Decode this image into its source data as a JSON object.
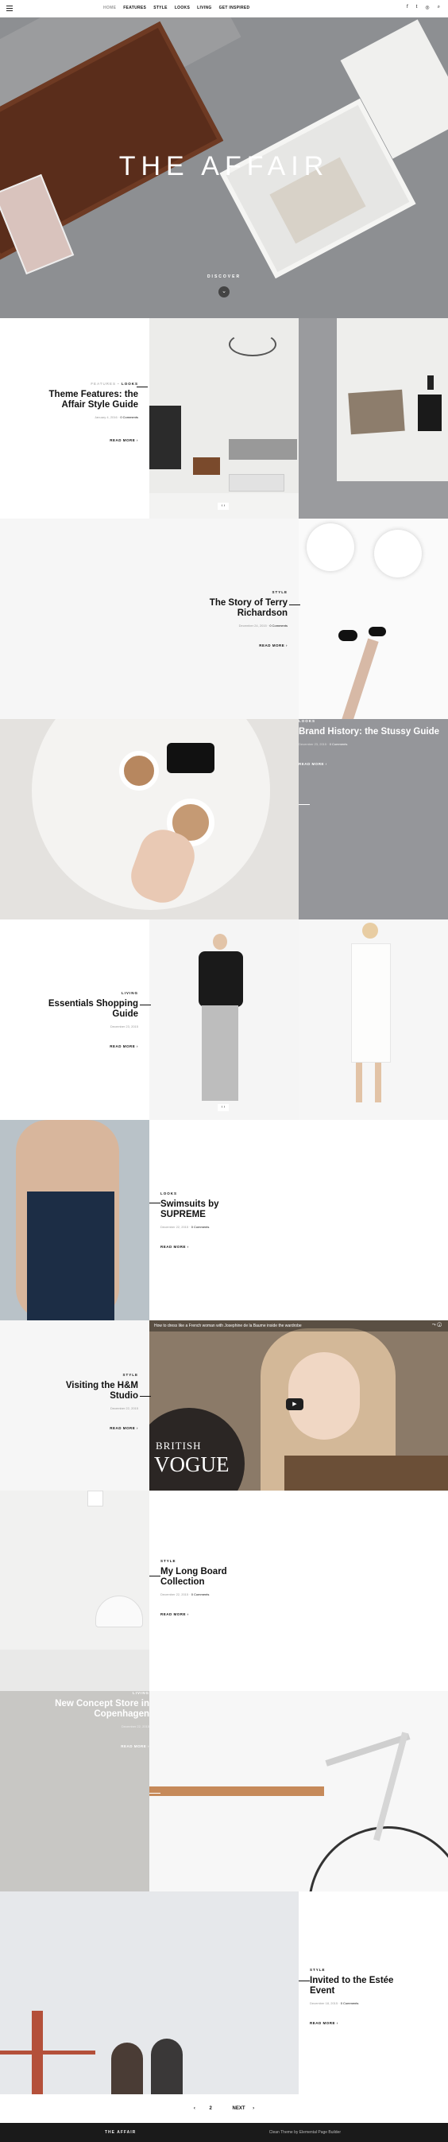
{
  "nav": {
    "links": [
      "HOME",
      "FEATURES",
      "STYLE",
      "LOOKS",
      "LIVING",
      "GET INSPIRED"
    ],
    "social": [
      "f",
      "t",
      "ig",
      "@"
    ]
  },
  "hero": {
    "title": "THE AFFAIR",
    "discover": "DISCOVER"
  },
  "posts": [
    {
      "cat_light": "FEATURES",
      "cat": "LOOKS",
      "title": "Theme Features: the Affair Style Guide",
      "date": "January 4, 2016",
      "comments": "0 Comments",
      "read": "READ MORE"
    },
    {
      "cat_light": "",
      "cat": "STYLE",
      "title": "The Story of Terry Richardson",
      "date": "December 24, 2015",
      "comments": "0 Comments",
      "read": "READ MORE"
    },
    {
      "cat_light": "",
      "cat": "LOOKS",
      "title": "Brand History: the Stussy Guide",
      "date": "December 23, 2015",
      "comments": "0 Comments",
      "read": "READ MORE"
    },
    {
      "cat_light": "",
      "cat": "LIVING",
      "title": "Essentials Shopping Guide",
      "date": "December 23, 2015",
      "comments": "",
      "read": "READ MORE"
    },
    {
      "cat_light": "",
      "cat": "LOOKS",
      "title": "Swimsuits by SUPREME",
      "date": "December 22, 2015",
      "comments": "0 Comments",
      "read": "READ MORE"
    },
    {
      "cat_light": "",
      "cat": "STYLE",
      "title": "Visiting the H&M Studio",
      "date": "December 22, 2015",
      "comments": "",
      "read": "READ MORE"
    },
    {
      "cat_light": "",
      "cat": "STYLE",
      "title": "My Long Board Collection",
      "date": "December 22, 2015",
      "comments": "0 Comments",
      "read": "READ MORE"
    },
    {
      "cat_light": "",
      "cat": "LIVING",
      "title": "New Concept Store in Copenhagen",
      "date": "December 22, 2015",
      "comments": "",
      "read": "READ MORE"
    },
    {
      "cat_light": "",
      "cat": "STYLE",
      "title": "Invited to the Estée Event",
      "date": "December 18, 2015",
      "comments": "0 Comments",
      "read": "READ MORE"
    }
  ],
  "video": {
    "caption": "How to dress like a French woman with Josephine de la Baume inside the wardrobe",
    "brand_top": "BRITISH",
    "brand_bottom": "VOGUE"
  },
  "pager": {
    "page": "2",
    "next": "NEXT"
  },
  "footer": {
    "left": "THE AFFAIR",
    "right": "Clean Theme by Elemental Page Builder"
  }
}
